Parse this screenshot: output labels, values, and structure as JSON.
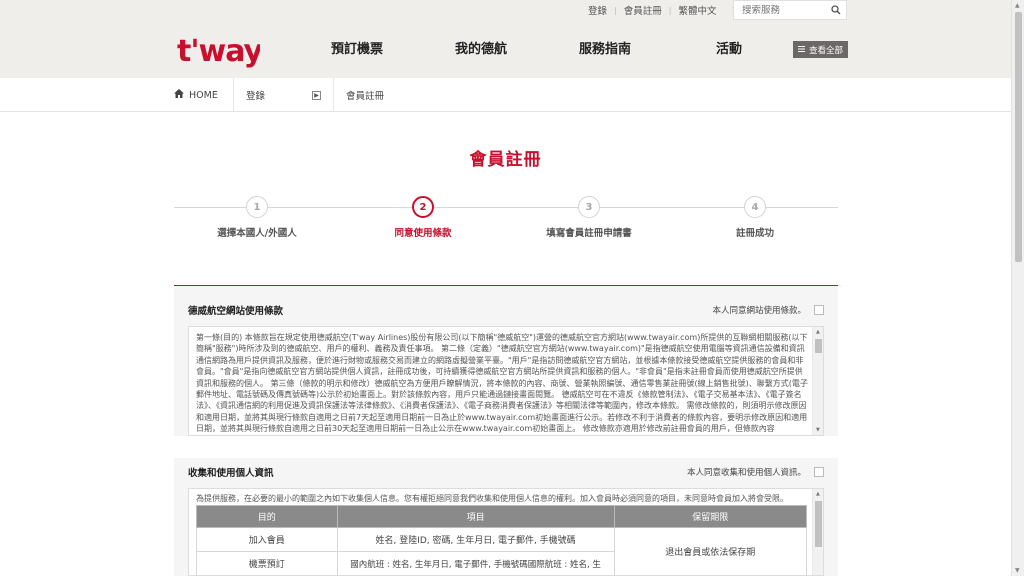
{
  "util": {
    "login": "登錄",
    "signup": "會員註冊",
    "language": "繁體中文",
    "search_placeholder": "搜索服務"
  },
  "header": {
    "logo_text": "t'way",
    "nav": [
      "預訂機票",
      "我的德航",
      "服務指南",
      "活動"
    ],
    "view_all": "查看全部"
  },
  "breadcrumb": {
    "home": "HOME",
    "login": "登錄",
    "current": "會員註冊"
  },
  "page_title": "會員註冊",
  "steps": [
    {
      "num": "1",
      "label": "選擇本國人/外國人",
      "active": false
    },
    {
      "num": "2",
      "label": "同意使用條款",
      "active": true
    },
    {
      "num": "3",
      "label": "填寫會員註冊申請書",
      "active": false
    },
    {
      "num": "4",
      "label": "註冊成功",
      "active": false
    }
  ],
  "terms": {
    "title": "德威航空網站使用條款",
    "agree_label": "本人同意網站使用條款。",
    "text": "第一條(目的) 本條款旨在規定使用德威航空(T'way Airlines)股份有限公司(以下簡稱\"德威航空\")運營的德威航空官方網站(www.twayair.com)所提供的互聯網相關服務(以下簡稱\"服務\")時所涉及到的德威航空、用戶的權利、義務及責任事項。 第二條（定義）\"德威航空官方網站(www.twayair.com)\"是指德威航空使用電腦等資訊通信設備和資訊通信網路為用戶提供資訊及服務，便於進行財物或服務交易而建立的網路虛擬營業平臺。\"用戶\"是指訪問德威航空官方網站，並根據本條款接受德威航空提供服務的會員和非會員。\"會員\"是指向德威航空官方網站提供個人資訊，註冊成功後，可持續獲得德威航空官方網站所提供資訊和服務的個人。\"非會員\"是指未註冊會員而使用德威航空所提供資訊和服務的個人。 第三條（條款的明示和修改）德威航空為方便用戶瞭解情況，將本條款的內容、商號、營業執照編號、通信零售業註冊號(線上銷售批號)、聯繫方式(電子郵件地址、電話號碼及傳真號碼等)公示於初始畫面上。對於該條款內容，用戶只能通過鏈接畫面閱覽。 德威航空可在不違反《條款管制法》、《電子交易基本法》、《電子簽名法》、《資訊通信網的利用促進及資訊保護法等法律條款》、《消費者保護法》、《電子商務消費者保護法》等相關法律等範圍內，修改本條款。 需修改條款的，則須明示修改原因和適用日期，並將其與現行條款自適用之日前7天起至適用日期前一日為止於www.twayair.com初始畫面進行公示。若修改不利于消費者的條款內容，要明示修改原因和適用日期，並將其與現行條款自適用之日前30天起至適用日期前一日為止公示在www.twayair.com初始畫面上。 修改條款亦適用於修改前註冊會員的用戶，但條款內容"
  },
  "personal_info": {
    "title": "收集和使用個人資訊",
    "agree_label": "本人同意收集和使用個人資訊。",
    "intro": "為提供服務，在必要的最小的範圍之內如下收集個人信息。您有權拒絕同意我們收集和使用個人信息的權利。加入會員時必須同意的項目，未同意時會員加入將會受限。",
    "headers": [
      "目的",
      "項目",
      "保留期限"
    ],
    "rows": [
      [
        "加入會員",
        "姓名, 登陸ID, 密碼, 生年月日, 電子郵件, 手機號碼"
      ],
      [
        "機票預訂",
        "國內航班 : 姓名, 生年月日, 電子郵件, 手機號碼國際航班 : 姓名, 生"
      ]
    ],
    "retention": "退出會員或依法保存期"
  },
  "colors": {
    "accent": "#c8102e",
    "header_bg": "#f0eeeb"
  }
}
